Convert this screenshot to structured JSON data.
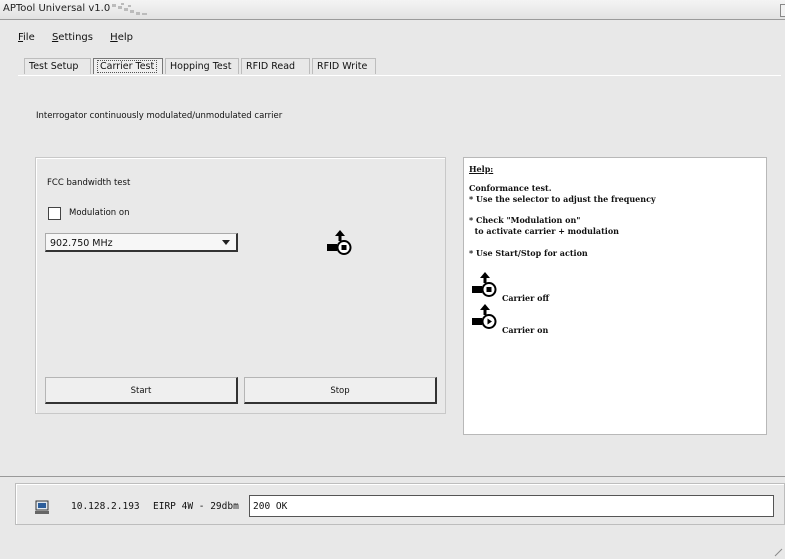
{
  "window": {
    "title": "APTool Universal v1.0"
  },
  "menu": {
    "file": "File",
    "settings": "Settings",
    "help": "Help"
  },
  "tabs": [
    "Test Setup",
    "Carrier Test",
    "Hopping Test",
    "RFID Read",
    "RFID Write"
  ],
  "active_tab": "Carrier Test",
  "carrier_test": {
    "description": "Interrogator continuously modulated/unmodulated carrier",
    "fcc_label": "FCC bandwidth test",
    "modulation_label": "Modulation on",
    "modulation_checked": false,
    "frequency": "902.750 MHz",
    "start_label": "Start",
    "stop_label": "Stop"
  },
  "help": {
    "title": "Help:",
    "lines": [
      "Conformance test.",
      "* Use the selector to adjust the frequency",
      "* Check \"Modulation on\"",
      "  to activate carrier + modulation",
      "* Use Start/Stop for action"
    ],
    "carrier_off": "Carrier off",
    "carrier_on": "Carrier on"
  },
  "status": {
    "ip": "10.128.2.193",
    "eirp": "EIRP 4W - 29dbm",
    "message": "200 OK"
  },
  "icons": {
    "status_icon": "network-computer-icon",
    "carrier_state": "carrier-off-icon"
  }
}
